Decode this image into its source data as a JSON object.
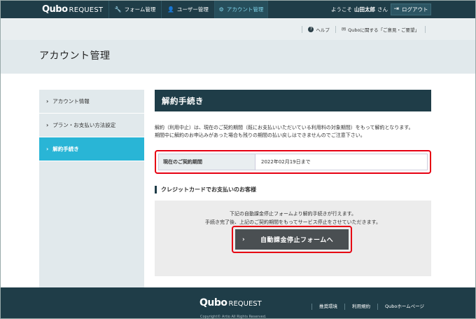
{
  "header": {
    "brand_q": "Qubo",
    "brand_r": "REQUEST",
    "nav": [
      {
        "label": "フォーム管理",
        "icon": "wrench-icon"
      },
      {
        "label": "ユーザー管理",
        "icon": "user-icon"
      },
      {
        "label": "アカウント管理",
        "icon": "gear-icon"
      }
    ],
    "welcome_prefix": "ようこそ",
    "user_name": "山田太郎",
    "welcome_suffix": "さん",
    "logout_label": "ログアウト"
  },
  "subbar": {
    "help_label": "ヘルプ",
    "feedback_label": "Quboに関する「ご意見・ご要望」"
  },
  "page_title": "アカウント管理",
  "sidebar": {
    "items": [
      {
        "label": "アカウント情報",
        "active": false
      },
      {
        "label": "プラン・お支払い方法設定",
        "active": false
      },
      {
        "label": "解約手続き",
        "active": true
      }
    ]
  },
  "main": {
    "section_title": "解約手続き",
    "desc_line1": "解約（利用中止）は、現在のご契約期間（既にお支払いいただいている利用料の対象期間）をもって解約となります。",
    "desc_line2": "期間中に解約のお申込みがあった場合も残りの期間の払い戻しはできませんのでご注意下さい。",
    "contract_label": "現在のご契約期間",
    "contract_value": "2022年02月19日まで",
    "credit_title": "クレジットカードでお支払いのお客様",
    "credit_line1": "下記の自動課金停止フォームより解約手続きが行えます。",
    "credit_line2": "手続き完了後、上記のご契約期間をもってサービス停止をさせていただきます。",
    "stop_button_label": "自動課金停止フォームへ"
  },
  "footer": {
    "brand_q": "Qubo",
    "brand_r": "REQUEST",
    "copyright": "Copyright© Artio All Rights Reserved.",
    "links": [
      "推奨環境",
      "利用規約",
      "Quboホームページ"
    ]
  },
  "colors": {
    "nav_bg": "#1f3d48",
    "accent": "#29b5d6",
    "highlight_border": "#e60012",
    "button_bg": "#4a4f52"
  }
}
